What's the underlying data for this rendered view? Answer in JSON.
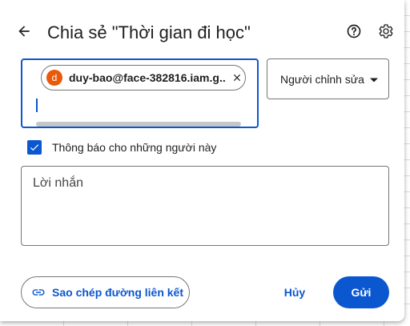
{
  "dialog": {
    "title": "Chia sẻ \"Thời gian đi học\"",
    "back_icon": "arrow-back-icon",
    "help_icon": "help-circle-icon",
    "settings_icon": "gear-icon"
  },
  "recipients": {
    "chips": [
      {
        "avatar_letter": "d",
        "email": "duy-bao@face-382816.iam.g...",
        "avatar_color": "#e8590c"
      }
    ],
    "remove_icon": "close-icon"
  },
  "role": {
    "selected": "Người chỉnh sửa",
    "arrow_icon": "dropdown-arrow-icon"
  },
  "notify": {
    "label": "Thông báo cho những người này",
    "checked": true
  },
  "message": {
    "placeholder": "Lời nhắn"
  },
  "footer": {
    "copy_link_label": "Sao chép đường liên kết",
    "copy_link_icon": "link-icon",
    "cancel_label": "Hủy",
    "send_label": "Gửi"
  },
  "colors": {
    "accent": "#0b57d0",
    "text": "#1f1f1f",
    "outline": "#747775"
  }
}
